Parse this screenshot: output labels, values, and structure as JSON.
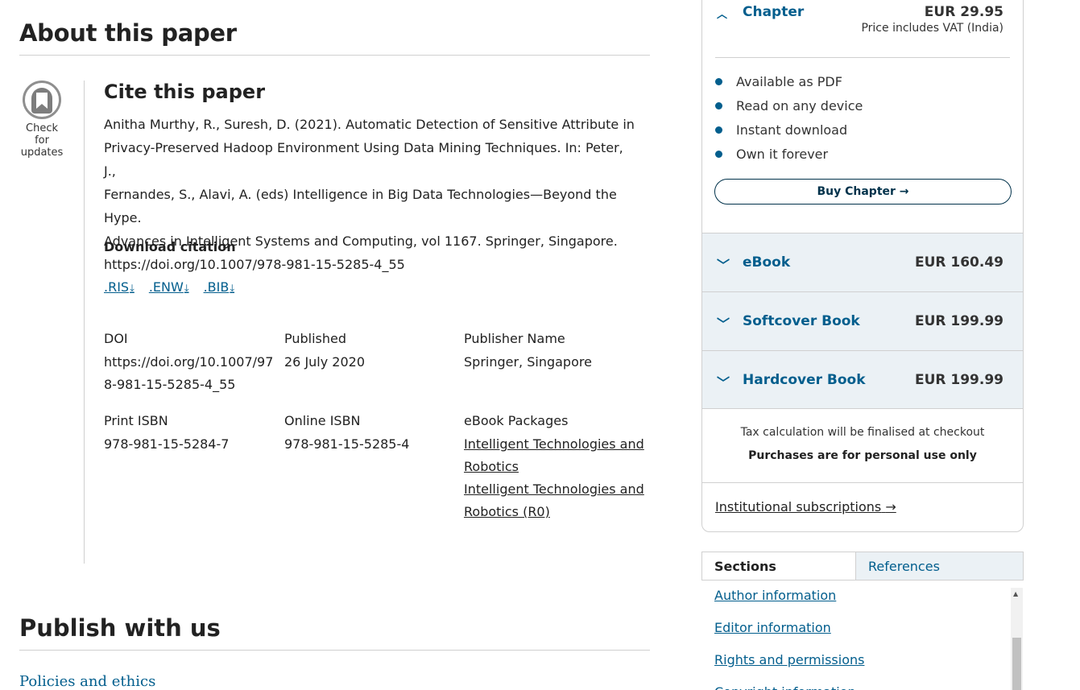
{
  "about": {
    "title": "About this paper"
  },
  "crossmark": {
    "label_line1": "Check for",
    "label_line2": "updates"
  },
  "cite": {
    "title": "Cite this paper",
    "text_line1": "Anitha Murthy, R., Suresh, D. (2021). Automatic Detection of Sensitive Attribute in",
    "text_line2": "Privacy-Preserved Hadoop Environment Using Data Mining Techniques. In: Peter, J.,",
    "text_line3": "Fernandes, S., Alavi, A. (eds) Intelligence in Big Data Technologies—Beyond the Hype.",
    "text_line4": "Advances in Intelligent Systems and Computing, vol 1167. Springer, Singapore.",
    "text_line5": "https://doi.org/10.1007/978-981-15-5285-4_55",
    "download_label": "Download citation",
    "formats": [
      ".RIS",
      ".ENW",
      ".BIB"
    ],
    "download_glyph": "⤓"
  },
  "meta": {
    "doi_label": "DOI",
    "doi_line1": "https://doi.org/10.1007/97",
    "doi_line2": "8-981-15-5285-4_55",
    "published_label": "Published",
    "published_value": "26 July 2020",
    "publisher_label": "Publisher Name",
    "publisher_value": "Springer, Singapore",
    "print_isbn_label": "Print ISBN",
    "print_isbn_value": "978-981-15-5284-7",
    "online_isbn_label": "Online ISBN",
    "online_isbn_value": "978-981-15-5285-4",
    "packages_label": "eBook Packages",
    "package1_line1": "Intelligent Technologies and",
    "package1_line2": "Robotics",
    "package2_line1": "Intelligent Technologies and",
    "package2_line2": "Robotics (R0)"
  },
  "publish": {
    "title": "Publish with us",
    "policies": "Policies and ethics"
  },
  "purchase": {
    "chapter_label": "Chapter",
    "chapter_price": "EUR 29.95",
    "vat_note": "Price includes VAT (India)",
    "features": [
      "Available as PDF",
      "Read on any device",
      "Instant download",
      "Own it forever"
    ],
    "buy_label": "Buy Chapter",
    "formats": [
      {
        "name": "eBook",
        "price": "EUR 160.49"
      },
      {
        "name": "Softcover Book",
        "price": "EUR 199.99"
      },
      {
        "name": "Hardcover Book",
        "price": "EUR 199.99"
      }
    ],
    "tax_note": "Tax calculation will be finalised at checkout",
    "personal_note": "Purchases are for personal use only",
    "institutional": "Institutional subscriptions"
  },
  "tabs": {
    "sections": "Sections",
    "references": "References"
  },
  "sections": [
    "Author information",
    "Editor information",
    "Rights and permissions",
    "Copyright information"
  ],
  "colors": {
    "link": "#025e8d",
    "tab_bg": "#ebf1f5",
    "text": "#222222"
  }
}
